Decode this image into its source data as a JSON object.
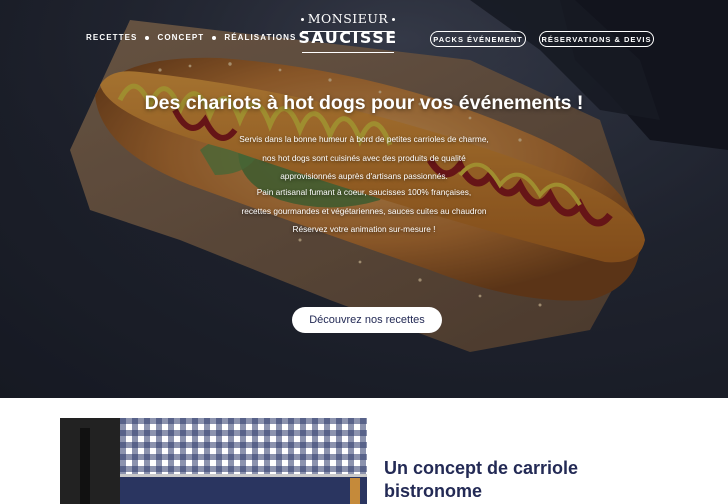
{
  "brand": {
    "logo_top": "MONSIEUR",
    "logo_bottom": "SAUCISSE"
  },
  "nav": {
    "items": [
      {
        "label": "RECETTES"
      },
      {
        "label": "CONCEPT"
      },
      {
        "label": "RÉALISATIONS"
      }
    ]
  },
  "header_buttons": {
    "packs": "PACKS ÉVÉNEMENT",
    "reservations": "RÉSERVATIONS & DEVIS"
  },
  "hero": {
    "title": "Des chariots à hot dogs pour vos événements !",
    "paragraph1": [
      "Servis dans la bonne humeur à bord de petites carrioles de charme,",
      "nos hot dogs sont cuisinés avec des produits de qualité",
      "approvisionnés auprès d'artisans passionnés."
    ],
    "paragraph2": [
      "Pain artisanal fumant à coeur, saucisses 100% françaises,",
      "recettes gourmandes et végétariennes, sauces cuites au chaudron",
      "Réservez votre animation sur-mesure !"
    ],
    "cta_label": "Découvrez nos recettes"
  },
  "concept": {
    "title_line1": "Un concept de carriole",
    "title_line2": "bistronome"
  },
  "colors": {
    "navy": "#232a55",
    "hero_bg": "#262b36",
    "white": "#ffffff"
  }
}
